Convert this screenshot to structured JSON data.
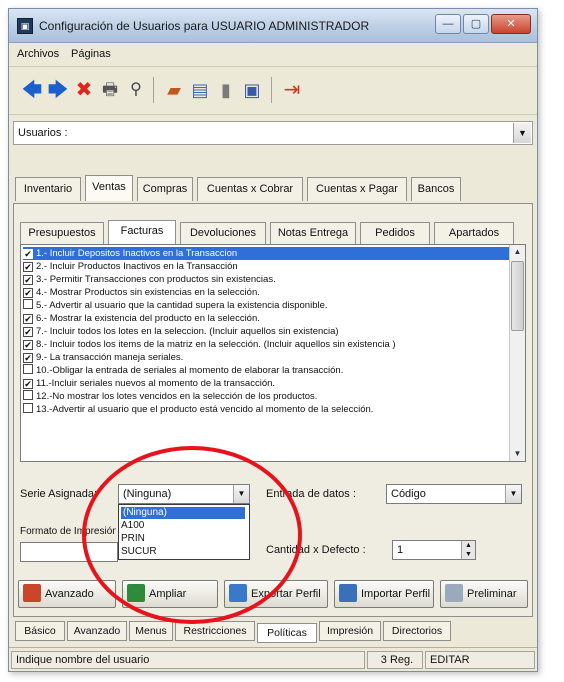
{
  "window": {
    "title": "Configuración de Usuarios para USUARIO ADMINISTRADOR",
    "icon": "app-icon"
  },
  "menubar": {
    "items": [
      "Archivos",
      "Páginas"
    ]
  },
  "toolbar": {
    "icons": [
      "back-arrow-icon",
      "forward-arrow-icon",
      "delete-x-icon",
      "print-icon",
      "search-icon",
      "new-folder-icon",
      "edit-document-icon",
      "trash-icon",
      "save-icon",
      "exit-door-icon"
    ],
    "colors": {
      "arrow": "#1b5fcf",
      "delete": "#e0261e",
      "exit": "#d23a1c"
    }
  },
  "users": {
    "label": "Usuarios :",
    "value": ""
  },
  "main_tabs": {
    "items": [
      "Inventario",
      "Ventas",
      "Compras",
      "Cuentas x Cobrar",
      "Cuentas x Pagar",
      "Bancos"
    ],
    "active": "Ventas"
  },
  "sub_tabs": {
    "items": [
      "Presupuestos",
      "Facturas",
      "Devoluciones",
      "Notas Entrega",
      "Pedidos",
      "Apartados"
    ],
    "active": "Facturas"
  },
  "options": [
    {
      "checked": true,
      "selected": true,
      "text": "1.- Incluir Depositos Inactivos en la Transaccion"
    },
    {
      "checked": true,
      "selected": false,
      "text": "2.- Incluir Productos Inactivos en la Transacción"
    },
    {
      "checked": true,
      "selected": false,
      "text": "3.- Permitir Transacciones con productos sin existencias."
    },
    {
      "checked": true,
      "selected": false,
      "text": "4.- Mostrar Productos sin existencias en la selección."
    },
    {
      "checked": false,
      "selected": false,
      "text": "5.- Advertir al usuario que la cantidad supera la existencia disponible."
    },
    {
      "checked": true,
      "selected": false,
      "text": "6.- Mostrar la existencia del producto en la selección."
    },
    {
      "checked": true,
      "selected": false,
      "text": "7.- Incluir todos los lotes en la seleccion. (Incluir aquellos sin existencia)"
    },
    {
      "checked": true,
      "selected": false,
      "text": "8.- Incluir todos los items de la matriz en la selección. (Incluir aquellos sin existencia )"
    },
    {
      "checked": true,
      "selected": false,
      "text": "9.- La transacción maneja seriales."
    },
    {
      "checked": false,
      "selected": false,
      "text": "10.-Obligar la entrada de seriales al momento de elaborar la transacción."
    },
    {
      "checked": true,
      "selected": false,
      "text": "11.-Incluir seriales nuevos al momento de la transacción."
    },
    {
      "checked": false,
      "selected": false,
      "text": "12.-No mostrar los lotes vencidos en la selección de los productos."
    },
    {
      "checked": false,
      "selected": false,
      "text": "13.-Advertir al usuario que el producto está vencido al momento de la selección."
    }
  ],
  "serie": {
    "label": "Serie Asignada:",
    "value": "(Ninguna)",
    "dropdown_options": [
      "(Ninguna)",
      "A100",
      "PRIN",
      "SUCUR"
    ]
  },
  "formato": {
    "label": "Formato de Impresión:"
  },
  "entrada": {
    "label": "Entrada de datos :",
    "value": "Código"
  },
  "cantidad": {
    "label": "Cantidad x Defecto :",
    "value": "1"
  },
  "buttons": [
    "Avanzado",
    "Ampliar",
    "Exportar Perfil",
    "Importar Perfil",
    "Preliminar"
  ],
  "bottom_tabs": {
    "items": [
      "Básico",
      "Avanzado",
      "Menus",
      "Restricciones",
      "Políticas",
      "Impresión",
      "Directorios"
    ],
    "active": "Políticas"
  },
  "status": {
    "hint": "Indique nombre del usuario",
    "reg": "3 Reg.",
    "mode": "EDITAR"
  },
  "annotation_color": "#e8121b"
}
